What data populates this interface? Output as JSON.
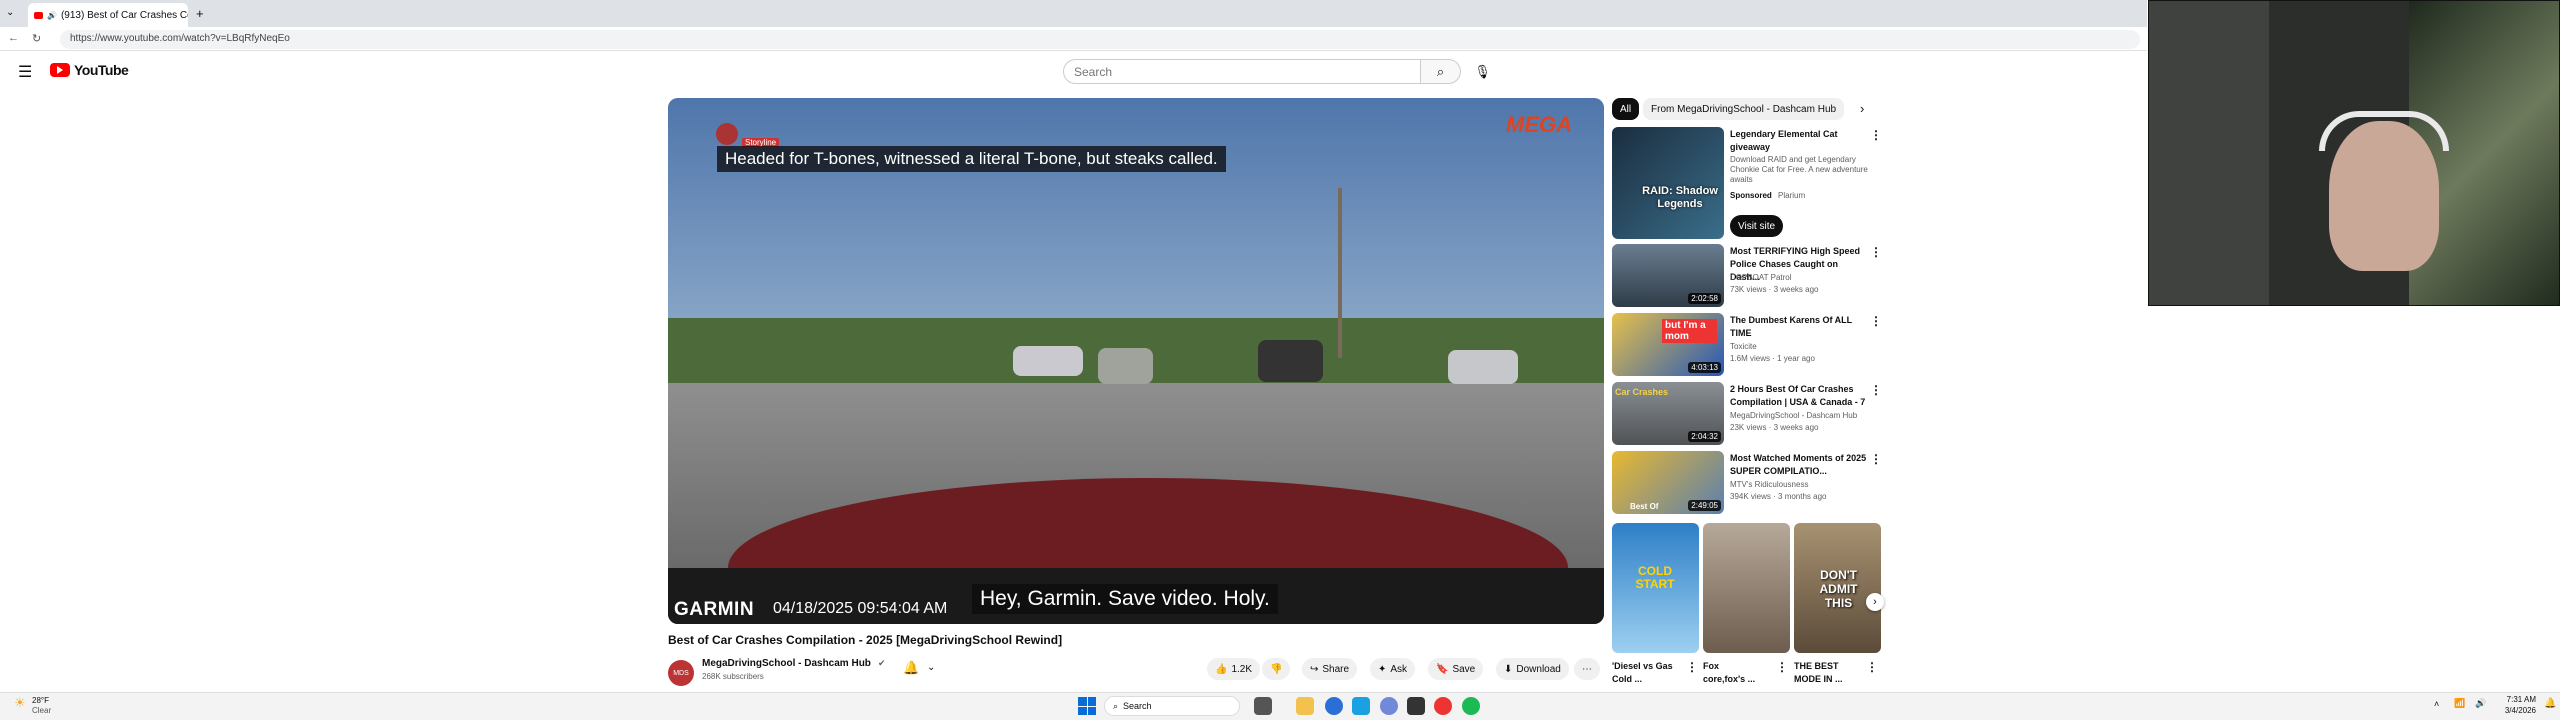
{
  "browser": {
    "tab_title": "(913) Best of Car Crashes Co...",
    "new_tab": "+",
    "url": "https://www.youtube.com/watch?v=LBqRfyNeqEo"
  },
  "header": {
    "logo_text": "YouTube",
    "search_placeholder": "Search"
  },
  "video": {
    "caption_top": "Headed for T-bones, witnessed a literal T-bone, but steaks called.",
    "storyline_label": "Storyline",
    "brand_badge": "MEGA",
    "dashcam_brand": "GARMIN",
    "dashcam_stamp": "04/18/2025 09:54:04 AM",
    "caption_bottom": "Hey, Garmin. Save video. Holy.",
    "title": "Best of Car Crashes Compilation - 2025 [MegaDrivingSchool Rewind]",
    "channel_name": "MegaDrivingSchool - Dashcam Hub",
    "subscribers": "268K subscribers",
    "like_count": "1.2K",
    "share_label": "Share",
    "ask_label": "Ask",
    "save_label": "Save",
    "download_label": "Download"
  },
  "filter_chips": [
    "All",
    "From MegaDrivingSchool - Dashcam Hub"
  ],
  "sponsored": {
    "title": "Legendary Elemental Cat giveaway",
    "description": "Download RAID and get Legendary Chonkie Cat for Free. A new adventure awaits",
    "sponsored_label": "Sponsored",
    "advertiser": "Plarium",
    "cta": "Visit site",
    "thumb_text": "RAID: Shadow Legends"
  },
  "recommendations": [
    {
      "title": "Most TERRIFYING High Speed Police Chases Caught on Dash...",
      "channel": "COPBOAT Patrol",
      "meta": "73K views · 3 weeks ago",
      "duration": "2:02:58",
      "thumb_text": ""
    },
    {
      "title": "The Dumbest Karens Of ALL TIME",
      "channel": "Toxicite",
      "meta": "1.6M views · 1 year ago",
      "duration": "4:03:13",
      "thumb_text": "but I'm a mom"
    },
    {
      "title": "2 Hours Best Of Car Crashes Compilation | USA & Canada - 7",
      "channel": "MegaDrivingSchool - Dashcam Hub",
      "meta": "23K views · 3 weeks ago",
      "duration": "2:04:32",
      "thumb_text": "Car Crashes"
    },
    {
      "title": "Most Watched Moments of 2025 SUPER COMPILATIO...",
      "channel": "MTV's Ridiculousness",
      "meta": "394K views · 3 months ago",
      "duration": "2:49:05",
      "thumb_text": "Best Of"
    }
  ],
  "shorts": [
    {
      "title": "'Diesel vs Gas Cold ...",
      "thumb_text": "COLD START"
    },
    {
      "title": "Fox core,fox's ...",
      "thumb_text": ""
    },
    {
      "title": "THE BEST MODE IN ...",
      "thumb_text": "DON'T ADMIT THIS"
    }
  ],
  "taskbar": {
    "weather_temp": "28°F",
    "weather_cond": "Clear",
    "search_label": "Search",
    "time": "7:31 AM",
    "date": "3/4/2026"
  }
}
